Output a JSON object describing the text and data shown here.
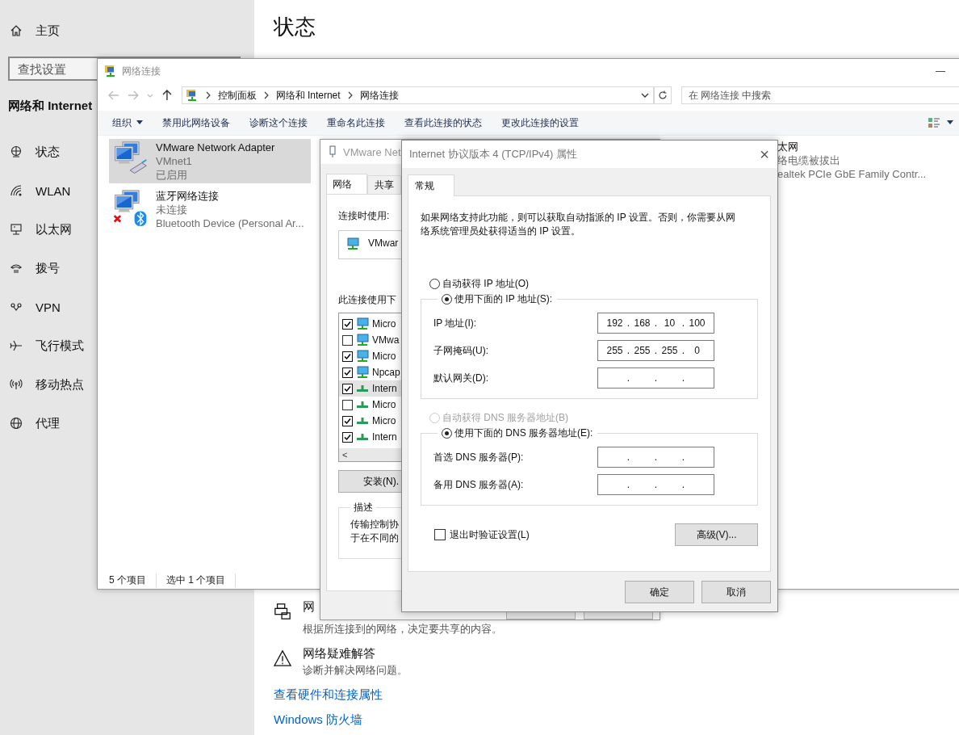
{
  "settings": {
    "home": "主页",
    "search": {
      "placeholder": "查找设置"
    },
    "section": "网络和 Internet",
    "items": [
      {
        "kind": "status",
        "label": "状态"
      },
      {
        "kind": "wlan",
        "label": "WLAN"
      },
      {
        "kind": "ethernet",
        "label": "以太网"
      },
      {
        "kind": "dialup",
        "label": "拨号"
      },
      {
        "kind": "vpn",
        "label": "VPN"
      },
      {
        "kind": "airplane",
        "label": "飞行模式"
      },
      {
        "kind": "hotspot",
        "label": "移动热点"
      },
      {
        "kind": "proxy",
        "label": "代理"
      }
    ],
    "page_title": "状态",
    "options": [
      {
        "kind": "share",
        "title": "网",
        "subtitle": "根据所连接到的网络，决定要共享的内容。"
      },
      {
        "kind": "warning",
        "title": "网络疑难解答",
        "subtitle": "诊断并解决网络问题。"
      }
    ],
    "links": [
      "查看硬件和连接属性",
      "Windows 防火墙"
    ]
  },
  "explorer": {
    "title": "网络连接",
    "minimize": "—",
    "breadcrumbs": [
      "控制面板",
      "网络和 Internet",
      "网络连接"
    ],
    "search": {
      "placeholder": "在 网络连接 中搜索"
    },
    "toolbar": [
      "组织",
      "禁用此网络设备",
      "诊断这个连接",
      "重命名此连接",
      "查看此连接的状态",
      "更改此连接的设置"
    ],
    "items": [
      {
        "kind": "vmware",
        "name": "VMware Network Adapter",
        "detail": "VMnet1",
        "status": "已启用",
        "selected": true
      },
      {
        "kind": "bluetooth",
        "name": "蓝牙网络连接",
        "detail": "未连接",
        "status": "Bluetooth Device (Personal Ar...",
        "selected": false
      }
    ],
    "peek_item": {
      "name": "太网",
      "detail": "络电缆被拔出",
      "status": "ealtek PCIe GbE Family Contr..."
    },
    "status_bar": [
      "5 个项目",
      "选中 1 个项目"
    ]
  },
  "adapter_dialog": {
    "title": "VMware Net",
    "tabs": [
      {
        "label": "网络",
        "selected": true
      },
      {
        "label": "共享",
        "selected": false
      }
    ],
    "connect_label": "连接时使用:",
    "adapter": "VMwar",
    "items_label": "此连接使用下",
    "items": [
      {
        "kind": "monitor",
        "label": "Micro",
        "checked": true,
        "selected": false
      },
      {
        "kind": "monitor",
        "label": "VMwa",
        "checked": false,
        "selected": false
      },
      {
        "kind": "monitor",
        "label": "Micro",
        "checked": true,
        "selected": false
      },
      {
        "kind": "monitor",
        "label": "Npcap",
        "checked": true,
        "selected": false
      },
      {
        "kind": "protocol",
        "label": "Intern",
        "checked": true,
        "selected": true
      },
      {
        "kind": "protocol",
        "label": "Micro",
        "checked": false,
        "selected": false
      },
      {
        "kind": "protocol",
        "label": "Micro",
        "checked": true,
        "selected": false
      },
      {
        "kind": "protocol",
        "label": "Intern",
        "checked": true,
        "selected": false
      }
    ],
    "scroll_left": "<",
    "install": "安装(N).",
    "description_label": "描述",
    "description_lines": [
      "传输控制协",
      "于在不同的"
    ]
  },
  "ipv4_dialog": {
    "title": "Internet 协议版本 4 (TCP/IPv4) 属性",
    "close": "×",
    "tab": "常规",
    "intro": "如果网络支持此功能，则可以获取自动指派的 IP 设置。否则，你需要从网络系统管理员处获得适当的 IP 设置。",
    "separator": ".",
    "ip_auto": {
      "label": "自动获得 IP 地址(O)",
      "selected": false,
      "disabled": false
    },
    "ip_manual": {
      "label": "使用下面的 IP 地址(S):",
      "selected": true,
      "disabled": false
    },
    "ip_fields": [
      {
        "label": "IP 地址(I):",
        "octets": [
          "192",
          "168",
          "10",
          "100"
        ]
      },
      {
        "label": "子网掩码(U):",
        "octets": [
          "255",
          "255",
          "255",
          "0"
        ]
      },
      {
        "label": "默认网关(D):"
      }
    ],
    "dns_auto": {
      "label": "自动获得 DNS 服务器地址(B)",
      "selected": false,
      "disabled": true
    },
    "dns_manual": {
      "label": "使用下面的 DNS 服务器地址(E):",
      "selected": true,
      "disabled": false
    },
    "dns_fields": [
      {
        "label": "首选 DNS 服务器(P):"
      },
      {
        "label": "备用 DNS 服务器(A):"
      }
    ],
    "validate": {
      "label": "退出时验证设置(L)",
      "checked": false
    },
    "advanced": "高级(V)...",
    "ok": "确定",
    "cancel": "取消"
  }
}
